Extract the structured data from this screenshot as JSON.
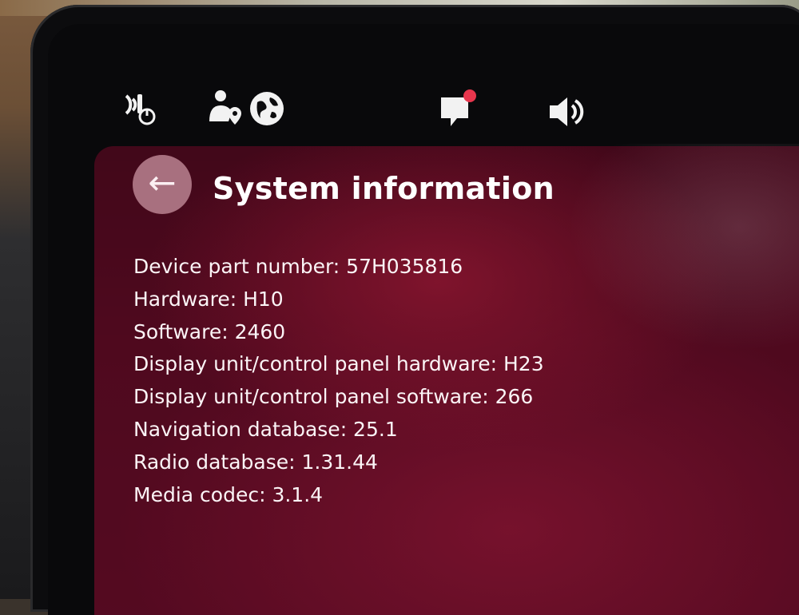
{
  "status_bar": {
    "icons": [
      "wireless-charging-icon",
      "user-location-icon",
      "globe-icon",
      "notification-icon",
      "volume-icon"
    ],
    "notification_color": "#e8364d"
  },
  "header": {
    "back_icon": "←",
    "title": "System information"
  },
  "info_items": [
    {
      "label": "Device part number: 57H035816"
    },
    {
      "label": "Hardware: H10"
    },
    {
      "label": "Software: 2460"
    },
    {
      "label": "Display unit/control panel hardware: H23"
    },
    {
      "label": "Display unit/control panel software: 266"
    },
    {
      "label": "Navigation database: 25.1"
    },
    {
      "label": "Radio database: 1.31.44"
    },
    {
      "label": "Media codec: 3.1.4"
    }
  ],
  "colors": {
    "accent": "#a8707f",
    "background": "#5c0b22",
    "text": "#ffffff"
  }
}
